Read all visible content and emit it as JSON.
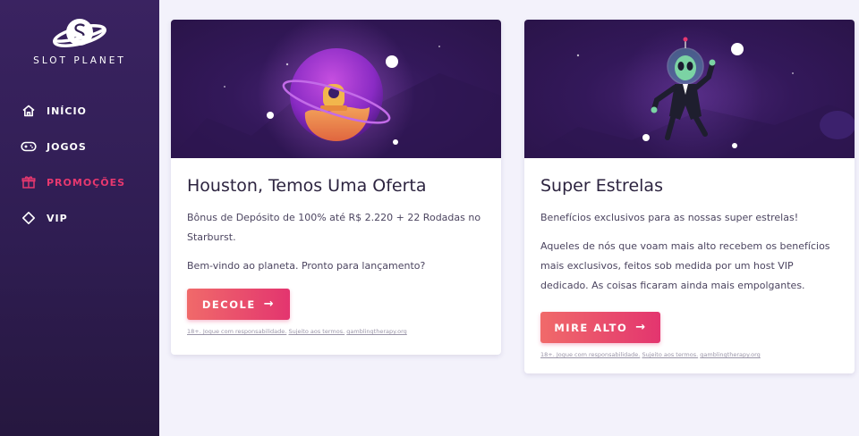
{
  "sidebar": {
    "logo_text": "SLOT PLANET",
    "items": [
      {
        "label": "INÍCIO",
        "icon": "home-icon"
      },
      {
        "label": "JOGOS",
        "icon": "gamepad-icon"
      },
      {
        "label": "PROMOÇÕES",
        "icon": "gift-icon",
        "active": true
      },
      {
        "label": "VIP",
        "icon": "diamond-icon"
      }
    ]
  },
  "promotions": [
    {
      "title": "Houston, Temos Uma Oferta",
      "paragraphs": [
        "Bônus de Depósito de 100% até R$ 2.220 + 22 Rodadas no Starburst.",
        "Bem-vindo ao planeta. Pronto para lançamento?"
      ],
      "cta": "DECOLE",
      "legal": [
        "18+. Jogue com responsabilidade.",
        "Sujeito aos termos.",
        "gamblingtherapy.org"
      ]
    },
    {
      "title": "Super Estrelas",
      "paragraphs": [
        "Benefícios exclusivos para as nossas super estrelas!",
        "Aqueles de nós que voam mais alto recebem os benefícios mais exclusivos, feitos sob medida por um host VIP dedicado. As coisas ficaram ainda mais empolgantes."
      ],
      "cta": "MIRE ALTO",
      "legal": [
        "18+. Jogue com responsabilidade.",
        "Sujeito aos termos.",
        "gamblingtherapy.org"
      ]
    }
  ],
  "colors": {
    "accent": "#e8386f",
    "sidebar_bg": "#2f1d52",
    "page_bg": "#f3f2fb",
    "button_start": "#f06a6a",
    "button_end": "#e3356f"
  }
}
